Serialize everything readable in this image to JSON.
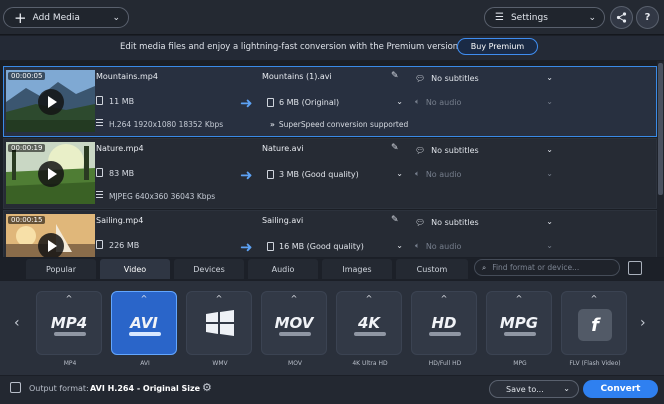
{
  "toolbar": {
    "add_media": "Add Media",
    "settings": "Settings"
  },
  "promo": {
    "text": "Edit media files and enjoy a lightning-fast conversion with the Premium version!",
    "button": "Buy Premium"
  },
  "files": [
    {
      "duration": "00:00:05",
      "name": "Mountains.mp4",
      "size": "11 MB",
      "codec": "H.264 1920x1080 18352 Kbps",
      "output_name": "Mountains (1).avi",
      "output_size": "6 MB (Original)",
      "subtitles": "No subtitles",
      "audio": "No audio",
      "superspeed": "SuperSpeed conversion supported",
      "selected": true
    },
    {
      "duration": "00:00:19",
      "name": "Nature.mp4",
      "size": "83 MB",
      "codec": "MJPEG 640x360 36043 Kbps",
      "output_name": "Nature.avi",
      "output_size": "3 MB (Good quality)",
      "subtitles": "No subtitles",
      "audio": "No audio",
      "selected": false
    },
    {
      "duration": "00:00:15",
      "name": "Sailing.mp4",
      "size": "226 MB",
      "output_name": "Sailing.avi",
      "output_size": "16 MB (Good quality)",
      "subtitles": "No subtitles",
      "audio": "No audio",
      "selected": false
    }
  ],
  "tabs": [
    "Popular",
    "Video",
    "Devices",
    "Audio",
    "Images",
    "Custom"
  ],
  "active_tab": "Video",
  "search": {
    "placeholder": "Find format or device..."
  },
  "formats": [
    {
      "logo": "MP4",
      "label": "MP4"
    },
    {
      "logo": "AVI",
      "label": "AVI",
      "active": true
    },
    {
      "logo": "",
      "label": "WMV",
      "icon": "windows-logo-icon"
    },
    {
      "logo": "MOV",
      "label": "MOV"
    },
    {
      "logo": "4K",
      "label": "4K Ultra HD"
    },
    {
      "logo": "HD",
      "label": "HD/Full HD"
    },
    {
      "logo": "MPG",
      "label": "MPG"
    },
    {
      "logo": "f",
      "label": "FLV (Flash Video)",
      "icon": "flash-icon"
    }
  ],
  "footer": {
    "output_label": "Output format:",
    "output_value": "AVI H.264 - Original Size",
    "save_to": "Save to...",
    "convert": "Convert"
  },
  "colors": {
    "accent": "#2f80f0",
    "selection": "#3a8be8"
  }
}
